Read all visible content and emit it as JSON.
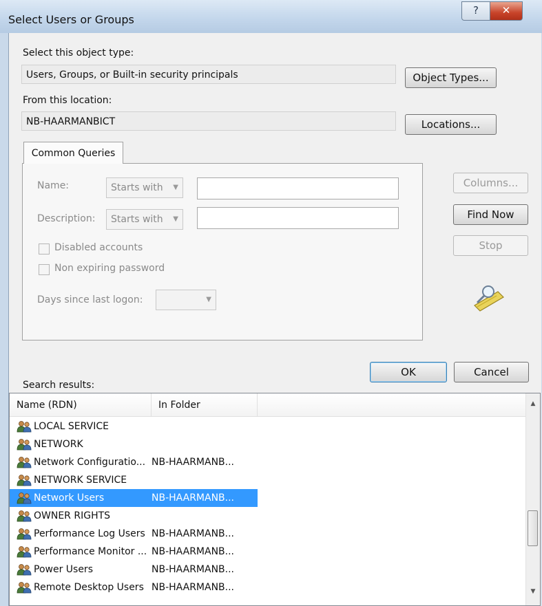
{
  "window": {
    "title": "Select Users or Groups",
    "help_glyph": "?",
    "close_glyph": "✕"
  },
  "object_type": {
    "label": "Select this object type:",
    "value": "Users, Groups, or Built-in security principals",
    "button": "Object Types..."
  },
  "location": {
    "label": "From this location:",
    "value": "NB-HAARMANBICT",
    "button": "Locations..."
  },
  "queries": {
    "tab_label": "Common Queries",
    "name_label": "Name:",
    "name_mode": "Starts with",
    "name_value": "",
    "description_label": "Description:",
    "description_mode": "Starts with",
    "description_value": "",
    "disabled_accounts_label": "Disabled accounts",
    "non_expiring_label": "Non expiring password",
    "days_label": "Days since last logon:",
    "days_value": ""
  },
  "actions": {
    "columns": "Columns...",
    "find_now": "Find Now",
    "stop": "Stop",
    "ok": "OK",
    "cancel": "Cancel"
  },
  "results": {
    "label": "Search results:",
    "columns": [
      "Name (RDN)",
      "In Folder"
    ],
    "rows": [
      {
        "name": "LOCAL SERVICE",
        "folder": ""
      },
      {
        "name": "NETWORK",
        "folder": ""
      },
      {
        "name": "Network Configuratio...",
        "folder": "NB-HAARMANB..."
      },
      {
        "name": "NETWORK SERVICE",
        "folder": ""
      },
      {
        "name": "Network Users",
        "folder": "NB-HAARMANB...",
        "selected": true
      },
      {
        "name": "OWNER RIGHTS",
        "folder": ""
      },
      {
        "name": "Performance Log Users",
        "folder": "NB-HAARMANB..."
      },
      {
        "name": "Performance Monitor ...",
        "folder": "NB-HAARMANB..."
      },
      {
        "name": "Power Users",
        "folder": "NB-HAARMANB..."
      },
      {
        "name": "Remote Desktop Users",
        "folder": "NB-HAARMANB..."
      }
    ]
  }
}
